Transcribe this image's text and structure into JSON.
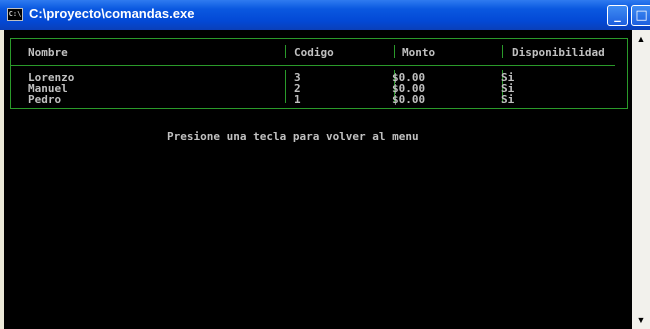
{
  "window": {
    "title": "C:\\proyecto\\comandas.exe",
    "icon_text": "C:\\",
    "buttons": {
      "minimize": "_",
      "maximize": "□"
    }
  },
  "table": {
    "columns": [
      "Nombre",
      "Codigo",
      "Monto",
      "Disponibilidad"
    ],
    "rows": [
      [
        "Lorenzo",
        "3",
        "$0.00",
        "Si"
      ],
      [
        "Manuel",
        "2",
        "$0.00",
        "Si"
      ],
      [
        "Pedro",
        "1",
        "$0.00",
        "Si"
      ]
    ]
  },
  "prompt": "Presione una tecla para volver al menu",
  "scrollbar": {
    "up_icon": "▲",
    "down_icon": "▼"
  },
  "colors": {
    "console_bg": "#000000",
    "console_text": "#c0c0c0",
    "table_border": "#2a9a2a",
    "titlebar": "#0a58e0"
  }
}
